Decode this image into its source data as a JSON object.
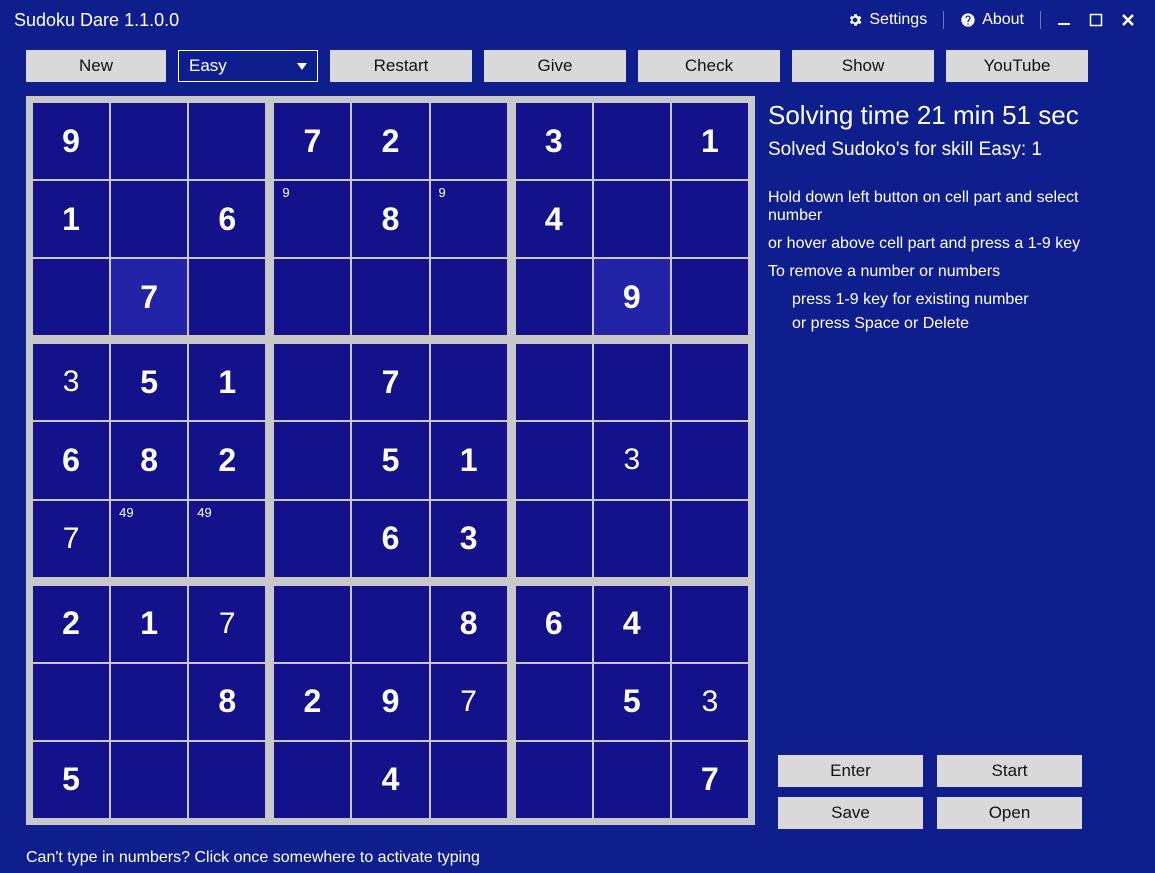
{
  "window": {
    "title": "Sudoku Dare 1.1.0.0",
    "settings_label": "Settings",
    "about_label": "About"
  },
  "toolbar": {
    "new_label": "New",
    "difficulty_selected": "Easy",
    "restart_label": "Restart",
    "give_label": "Give",
    "check_label": "Check",
    "show_label": "Show",
    "youtube_label": "YouTube"
  },
  "side": {
    "timer": "Solving time 21 min 51 sec",
    "solved": "Solved Sudoko's for skill Easy: 1",
    "hint1": "Hold down left button on cell part and select number",
    "hint2": "or hover above cell part and press a 1-9 key",
    "hint3": "To remove a number or numbers",
    "hint4": "press 1-9 key for existing number",
    "hint5": "or press Space or Delete"
  },
  "bottom": {
    "enter_label": "Enter",
    "start_label": "Start",
    "save_label": "Save",
    "open_label": "Open"
  },
  "footer": {
    "hint": "Can't type in numbers? Click once somewhere to activate typing"
  },
  "board": {
    "cells": [
      [
        {
          "v": "9",
          "b": true
        },
        {
          "v": ""
        },
        {
          "v": ""
        },
        {
          "v": "7",
          "b": true
        },
        {
          "v": "2",
          "b": true
        },
        {
          "v": ""
        },
        {
          "v": "3",
          "b": true
        },
        {
          "v": ""
        },
        {
          "v": "1",
          "b": true
        }
      ],
      [
        {
          "v": "1",
          "b": true
        },
        {
          "v": ""
        },
        {
          "v": "6",
          "b": true
        },
        {
          "v": "",
          "n": "9"
        },
        {
          "v": "8",
          "b": true
        },
        {
          "v": "",
          "n": "9"
        },
        {
          "v": "4",
          "b": true
        },
        {
          "v": ""
        },
        {
          "v": ""
        }
      ],
      [
        {
          "v": ""
        },
        {
          "v": "7",
          "b": true,
          "h": true
        },
        {
          "v": ""
        },
        {
          "v": ""
        },
        {
          "v": ""
        },
        {
          "v": ""
        },
        {
          "v": ""
        },
        {
          "v": "9",
          "b": true,
          "h": true
        },
        {
          "v": ""
        }
      ],
      [
        {
          "v": "3"
        },
        {
          "v": "5",
          "b": true
        },
        {
          "v": "1",
          "b": true
        },
        {
          "v": ""
        },
        {
          "v": "7",
          "b": true
        },
        {
          "v": ""
        },
        {
          "v": ""
        },
        {
          "v": ""
        },
        {
          "v": ""
        }
      ],
      [
        {
          "v": "6",
          "b": true
        },
        {
          "v": "8",
          "b": true
        },
        {
          "v": "2",
          "b": true
        },
        {
          "v": ""
        },
        {
          "v": "5",
          "b": true
        },
        {
          "v": "1",
          "b": true
        },
        {
          "v": ""
        },
        {
          "v": "3"
        },
        {
          "v": ""
        }
      ],
      [
        {
          "v": "7"
        },
        {
          "v": "",
          "n": "49"
        },
        {
          "v": "",
          "n": "49"
        },
        {
          "v": ""
        },
        {
          "v": "6",
          "b": true
        },
        {
          "v": "3",
          "b": true
        },
        {
          "v": ""
        },
        {
          "v": ""
        },
        {
          "v": ""
        }
      ],
      [
        {
          "v": "2",
          "b": true
        },
        {
          "v": "1",
          "b": true
        },
        {
          "v": "7"
        },
        {
          "v": ""
        },
        {
          "v": ""
        },
        {
          "v": "8",
          "b": true
        },
        {
          "v": "6",
          "b": true
        },
        {
          "v": "4",
          "b": true
        },
        {
          "v": ""
        }
      ],
      [
        {
          "v": ""
        },
        {
          "v": ""
        },
        {
          "v": "8",
          "b": true
        },
        {
          "v": "2",
          "b": true
        },
        {
          "v": "9",
          "b": true
        },
        {
          "v": "7"
        },
        {
          "v": ""
        },
        {
          "v": "5",
          "b": true
        },
        {
          "v": "3"
        }
      ],
      [
        {
          "v": "5",
          "b": true
        },
        {
          "v": ""
        },
        {
          "v": ""
        },
        {
          "v": ""
        },
        {
          "v": "4",
          "b": true
        },
        {
          "v": ""
        },
        {
          "v": ""
        },
        {
          "v": ""
        },
        {
          "v": "7",
          "b": true
        }
      ]
    ]
  }
}
